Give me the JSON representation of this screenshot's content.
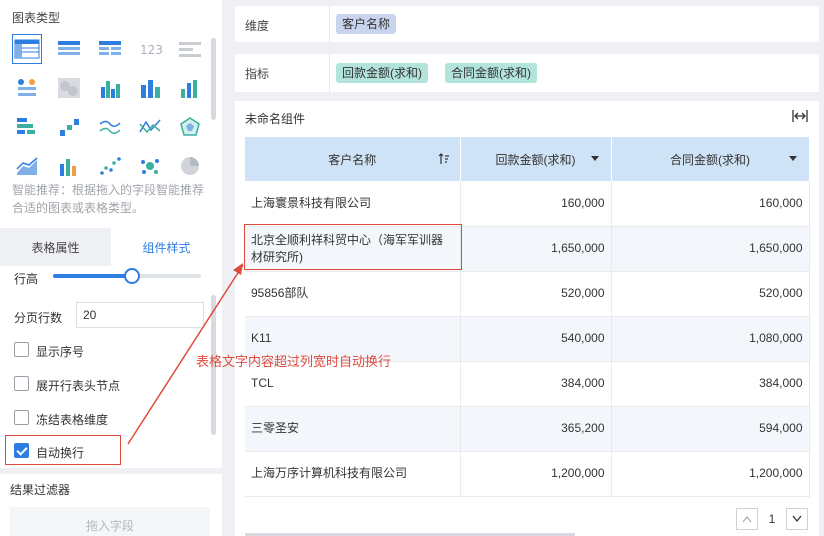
{
  "left_panel": {
    "chart_type_title": "图表类型",
    "chart_icons": [
      "table-icon",
      "cross-table-icon",
      "detail-table-icon",
      "number-card-icon",
      "kpi-icon",
      "dot-map-icon",
      "heat-map-icon",
      "grouped-bar-icon",
      "stacked-bar-icon",
      "column-bar-icon",
      "horizontal-bar-icon",
      "waterfall-icon",
      "line-icon",
      "radar-line-icon",
      "radar-icon",
      "area-icon",
      "combo-icon",
      "scatter-icon",
      "bubble-icon",
      "pie-icon"
    ],
    "hint": "智能推荐：根据拖入的字段智能推荐合适的图表或表格类型。",
    "tabs": [
      {
        "label": "表格属性",
        "active": false
      },
      {
        "label": "组件样式",
        "active": true
      }
    ],
    "row_height_label": "行高",
    "row_height_value": 0.55,
    "page_rows_label": "分页行数",
    "page_rows_value": "20",
    "checkboxes": [
      {
        "label": "显示序号",
        "checked": false
      },
      {
        "label": "展开行表头节点",
        "checked": false
      },
      {
        "label": "冻结表格维度",
        "checked": false
      },
      {
        "label": "自动换行",
        "checked": true
      }
    ],
    "filter_title": "结果过滤器",
    "drop_zone": "拖入字段"
  },
  "dimension": {
    "label": "维度",
    "fields": [
      "客户名称"
    ]
  },
  "indicator": {
    "label": "指标",
    "fields": [
      "回款金额(求和)",
      "合同金额(求和)"
    ]
  },
  "table": {
    "title": "未命名组件",
    "columns": [
      "客户名称",
      "回款金额(求和)",
      "合同金额(求和)"
    ],
    "rows": [
      [
        "上海寰景科技有限公司",
        "160,000",
        "160,000"
      ],
      [
        "北京全顺利祥科贸中心（海军军训器材研究所)",
        "1,650,000",
        "1,650,000"
      ],
      [
        "95856部队",
        "520,000",
        "520,000"
      ],
      [
        "K11",
        "540,000",
        "1,080,000"
      ],
      [
        "TCL",
        "384,000",
        "384,000"
      ],
      [
        "三零圣安",
        "365,200",
        "594,000"
      ],
      [
        "上海万序计算机科技有限公司",
        "1,200,000",
        "1,200,000"
      ]
    ]
  },
  "annotation": "表格文字内容超过列宽时自动换行",
  "pager": {
    "current_page": "1"
  },
  "colors": {
    "accent": "#2e7de0",
    "annotation": "#e04a3c",
    "header_bg": "#cfe3f7",
    "dim_pill": "#c9d4ee",
    "ind_pill": "#b2e4dc"
  }
}
